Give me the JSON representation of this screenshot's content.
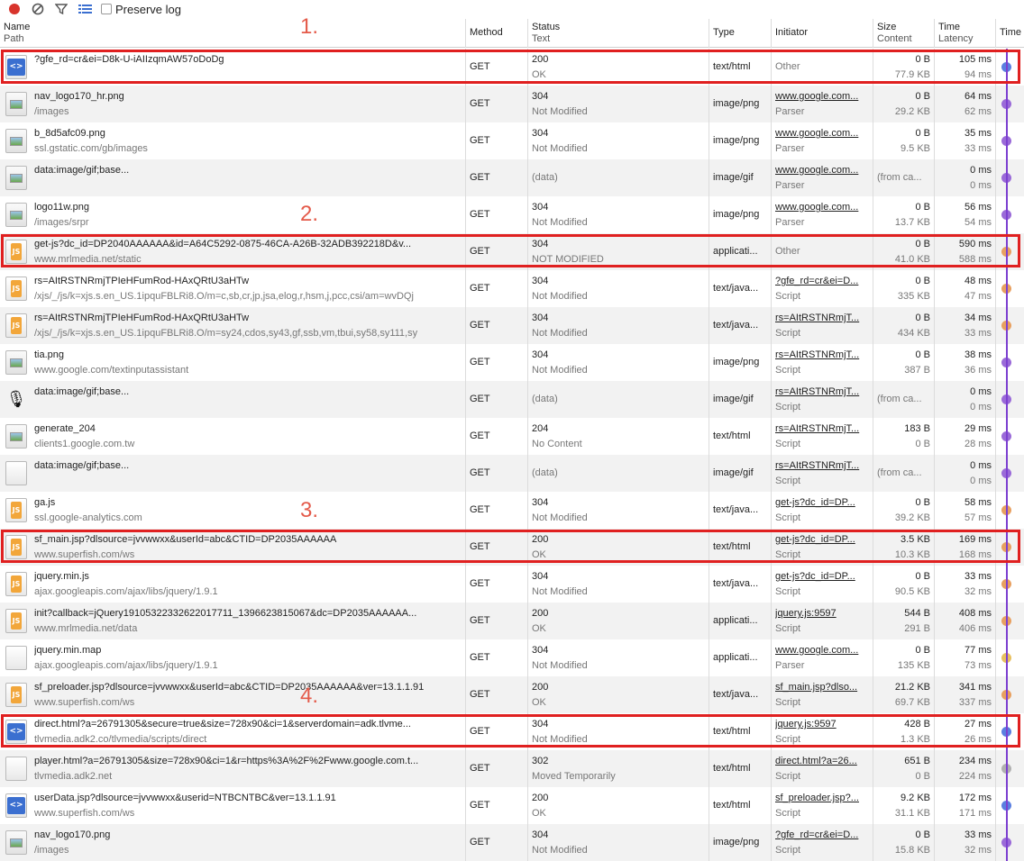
{
  "toolbar": {
    "record_icon": "record-icon",
    "clear_icon": "clear-icon",
    "filter_icon": "filter-icon",
    "list_icon": "list-view-icon",
    "preserve_log_label": "Preserve log"
  },
  "columns": {
    "name": "Name",
    "name_sub": "Path",
    "method": "Method",
    "status": "Status",
    "status_sub": "Text",
    "type": "Type",
    "initiator": "Initiator",
    "size": "Size",
    "size_sub": "Content",
    "time": "Time",
    "time_sub": "Latency",
    "timeline": "Time"
  },
  "annotations": [
    "1.",
    "2.",
    "3.",
    "4."
  ],
  "colors": {
    "highlight": "#e02020",
    "timeline": "#7c3fd0"
  },
  "rows": [
    {
      "icon": "html",
      "name": "?gfe_rd=cr&ei=D8k-U-iAIIzqmAW57oDoDg",
      "path": "",
      "method": "GET",
      "status": "200",
      "status_text": "OK",
      "type": "text/html",
      "initiator": "Other",
      "initiator_sub": "",
      "init_link": false,
      "size": "0 B",
      "content": "77.9 KB",
      "time": "105 ms",
      "latency": "94 ms",
      "dot": "#5a7fe0"
    },
    {
      "icon": "img",
      "name": "nav_logo170_hr.png",
      "path": "/images",
      "method": "GET",
      "status": "304",
      "status_text": "Not Modified",
      "type": "image/png",
      "initiator": "www.google.com...",
      "initiator_sub": "Parser",
      "init_link": true,
      "size": "0 B",
      "content": "29.2 KB",
      "time": "64 ms",
      "latency": "62 ms",
      "dot": "#9a6ad8"
    },
    {
      "icon": "img",
      "name": "b_8d5afc09.png",
      "path": "ssl.gstatic.com/gb/images",
      "method": "GET",
      "status": "304",
      "status_text": "Not Modified",
      "type": "image/png",
      "initiator": "www.google.com...",
      "initiator_sub": "Parser",
      "init_link": true,
      "size": "0 B",
      "content": "9.5 KB",
      "time": "35 ms",
      "latency": "33 ms",
      "dot": "#9a6ad8"
    },
    {
      "icon": "img",
      "name": "data:image/gif;base...",
      "path": "",
      "method": "GET",
      "status": "",
      "status_text": "(data)",
      "type": "image/gif",
      "initiator": "www.google.com...",
      "initiator_sub": "Parser",
      "init_link": true,
      "size": "",
      "content": "",
      "size_single": "(from ca...",
      "time": "0 ms",
      "latency": "0 ms",
      "dot": "#9a6ad8"
    },
    {
      "icon": "img",
      "name": "logo11w.png",
      "path": "/images/srpr",
      "method": "GET",
      "status": "304",
      "status_text": "Not Modified",
      "type": "image/png",
      "initiator": "www.google.com...",
      "initiator_sub": "Parser",
      "init_link": true,
      "size": "0 B",
      "content": "13.7 KB",
      "time": "56 ms",
      "latency": "54 ms",
      "dot": "#9a6ad8"
    },
    {
      "icon": "js",
      "name": "get-js?dc_id=DP2040AAAAAA&id=A64C5292-0875-46CA-A26B-32ADB392218D&v...",
      "path": "www.mrlmedia.net/static",
      "method": "GET",
      "status": "304",
      "status_text": "NOT MODIFIED",
      "type": "applicati...",
      "initiator": "Other",
      "initiator_sub": "",
      "init_link": false,
      "size": "0 B",
      "content": "41.0 KB",
      "time": "590 ms",
      "latency": "588 ms",
      "dot": "#e8a060"
    },
    {
      "icon": "js",
      "name": "rs=AItRSTNRmjTPIeHFumRod-HAxQRtU3aHTw",
      "path": "/xjs/_/js/k=xjs.s.en_US.1ipquFBLRi8.O/m=c,sb,cr,jp,jsa,elog,r,hsm,j,pcc,csi/am=wvDQj",
      "method": "GET",
      "status": "304",
      "status_text": "Not Modified",
      "type": "text/java...",
      "initiator": "?gfe_rd=cr&ei=D...",
      "initiator_sub": "Script",
      "init_link": true,
      "size": "0 B",
      "content": "335 KB",
      "time": "48 ms",
      "latency": "47 ms",
      "dot": "#e8a060"
    },
    {
      "icon": "js",
      "name": "rs=AItRSTNRmjTPIeHFumRod-HAxQRtU3aHTw",
      "path": "/xjs/_/js/k=xjs.s.en_US.1ipquFBLRi8.O/m=sy24,cdos,sy43,gf,ssb,vm,tbui,sy58,sy111,sy",
      "method": "GET",
      "status": "304",
      "status_text": "Not Modified",
      "type": "text/java...",
      "initiator": "rs=AItRSTNRmjT...",
      "initiator_sub": "Script",
      "init_link": true,
      "size": "0 B",
      "content": "434 KB",
      "time": "34 ms",
      "latency": "33 ms",
      "dot": "#e8a060"
    },
    {
      "icon": "img",
      "name": "tia.png",
      "path": "www.google.com/textinputassistant",
      "method": "GET",
      "status": "304",
      "status_text": "Not Modified",
      "type": "image/png",
      "initiator": "rs=AItRSTNRmjT...",
      "initiator_sub": "Script",
      "init_link": true,
      "size": "0 B",
      "content": "387 B",
      "time": "38 ms",
      "latency": "36 ms",
      "dot": "#9a6ad8"
    },
    {
      "icon": "mic",
      "name": "data:image/gif;base...",
      "path": "",
      "method": "GET",
      "status": "",
      "status_text": "(data)",
      "type": "image/gif",
      "initiator": "rs=AItRSTNRmjT...",
      "initiator_sub": "Script",
      "init_link": true,
      "size": "",
      "content": "",
      "size_single": "(from ca...",
      "time": "0 ms",
      "latency": "0 ms",
      "dot": "#9a6ad8"
    },
    {
      "icon": "img",
      "name": "generate_204",
      "path": "clients1.google.com.tw",
      "method": "GET",
      "status": "204",
      "status_text": "No Content",
      "type": "text/html",
      "initiator": "rs=AItRSTNRmjT...",
      "initiator_sub": "Script",
      "init_link": true,
      "size": "183 B",
      "content": "0 B",
      "time": "29 ms",
      "latency": "28 ms",
      "dot": "#9a6ad8"
    },
    {
      "icon": "blank",
      "name": "data:image/gif;base...",
      "path": "",
      "method": "GET",
      "status": "",
      "status_text": "(data)",
      "type": "image/gif",
      "initiator": "rs=AItRSTNRmjT...",
      "initiator_sub": "Script",
      "init_link": true,
      "size": "",
      "content": "",
      "size_single": "(from ca...",
      "time": "0 ms",
      "latency": "0 ms",
      "dot": "#9a6ad8"
    },
    {
      "icon": "js",
      "name": "ga.js",
      "path": "ssl.google-analytics.com",
      "method": "GET",
      "status": "304",
      "status_text": "Not Modified",
      "type": "text/java...",
      "initiator": "get-js?dc_id=DP...",
      "initiator_sub": "Script",
      "init_link": true,
      "size": "0 B",
      "content": "39.2 KB",
      "time": "58 ms",
      "latency": "57 ms",
      "dot": "#e8a060"
    },
    {
      "icon": "js",
      "name": "sf_main.jsp?dlsource=jvvwwxx&userId=abc&CTID=DP2035AAAAAA",
      "path": "www.superfish.com/ws",
      "method": "GET",
      "status": "200",
      "status_text": "OK",
      "type": "text/html",
      "initiator": "get-js?dc_id=DP...",
      "initiator_sub": "Script",
      "init_link": true,
      "size": "3.5 KB",
      "content": "10.3 KB",
      "time": "169 ms",
      "latency": "168 ms",
      "dot": "#e8a060"
    },
    {
      "icon": "js",
      "name": "jquery.min.js",
      "path": "ajax.googleapis.com/ajax/libs/jquery/1.9.1",
      "method": "GET",
      "status": "304",
      "status_text": "Not Modified",
      "type": "text/java...",
      "initiator": "get-js?dc_id=DP...",
      "initiator_sub": "Script",
      "init_link": true,
      "size": "0 B",
      "content": "90.5 KB",
      "time": "33 ms",
      "latency": "32 ms",
      "dot": "#e8a060"
    },
    {
      "icon": "js",
      "name": "init?callback=jQuery19105322332622017711_1396623815067&dc=DP2035AAAAAA...",
      "path": "www.mrlmedia.net/data",
      "method": "GET",
      "status": "200",
      "status_text": "OK",
      "type": "applicati...",
      "initiator": "jquery.js:9597",
      "initiator_sub": "Script",
      "init_link": true,
      "size": "544 B",
      "content": "291 B",
      "time": "408 ms",
      "latency": "406 ms",
      "dot": "#e8a060"
    },
    {
      "icon": "blank",
      "name": "jquery.min.map",
      "path": "ajax.googleapis.com/ajax/libs/jquery/1.9.1",
      "method": "GET",
      "status": "304",
      "status_text": "Not Modified",
      "type": "applicati...",
      "initiator": "www.google.com...",
      "initiator_sub": "Parser",
      "init_link": true,
      "size": "0 B",
      "content": "135 KB",
      "time": "77 ms",
      "latency": "73 ms",
      "dot": "#e8c060"
    },
    {
      "icon": "js",
      "name": "sf_preloader.jsp?dlsource=jvvwwxx&userId=abc&CTID=DP2035AAAAAA&ver=13.1.1.91",
      "path": "www.superfish.com/ws",
      "method": "GET",
      "status": "200",
      "status_text": "OK",
      "type": "text/java...",
      "initiator": "sf_main.jsp?dlso...",
      "initiator_sub": "Script",
      "init_link": true,
      "size": "21.2 KB",
      "content": "69.7 KB",
      "time": "341 ms",
      "latency": "337 ms",
      "dot": "#e8a060"
    },
    {
      "icon": "html",
      "name": "direct.html?a=26791305&secure=true&size=728x90&ci=1&serverdomain=adk.tlvme...",
      "path": "tlvmedia.adk2.co/tlvmedia/scripts/direct",
      "method": "GET",
      "status": "304",
      "status_text": "Not Modified",
      "type": "text/html",
      "initiator": "jquery.js:9597",
      "initiator_sub": "Script",
      "init_link": true,
      "size": "428 B",
      "content": "1.3 KB",
      "time": "27 ms",
      "latency": "26 ms",
      "dot": "#5a7fe0"
    },
    {
      "icon": "blank",
      "name": "player.html?a=26791305&size=728x90&ci=1&r=https%3A%2F%2Fwww.google.com.t...",
      "path": "tlvmedia.adk2.net",
      "method": "GET",
      "status": "302",
      "status_text": "Moved Temporarily",
      "type": "text/html",
      "initiator": "direct.html?a=26...",
      "initiator_sub": "Script",
      "init_link": true,
      "size": "651 B",
      "content": "0 B",
      "time": "234 ms",
      "latency": "224 ms",
      "dot": "#b0b0b0"
    },
    {
      "icon": "html",
      "name": "userData.jsp?dlsource=jvvwwxx&userid=NTBCNTBC&ver=13.1.1.91",
      "path": "www.superfish.com/ws",
      "method": "GET",
      "status": "200",
      "status_text": "OK",
      "type": "text/html",
      "initiator": "sf_preloader.jsp?...",
      "initiator_sub": "Script",
      "init_link": true,
      "size": "9.2 KB",
      "content": "31.1 KB",
      "time": "172 ms",
      "latency": "171 ms",
      "dot": "#5a7fe0"
    },
    {
      "icon": "img",
      "name": "nav_logo170.png",
      "path": "/images",
      "method": "GET",
      "status": "304",
      "status_text": "Not Modified",
      "type": "image/png",
      "initiator": "?gfe_rd=cr&ei=D...",
      "initiator_sub": "Script",
      "init_link": true,
      "size": "0 B",
      "content": "15.8 KB",
      "time": "33 ms",
      "latency": "32 ms",
      "dot": "#9a6ad8"
    }
  ]
}
